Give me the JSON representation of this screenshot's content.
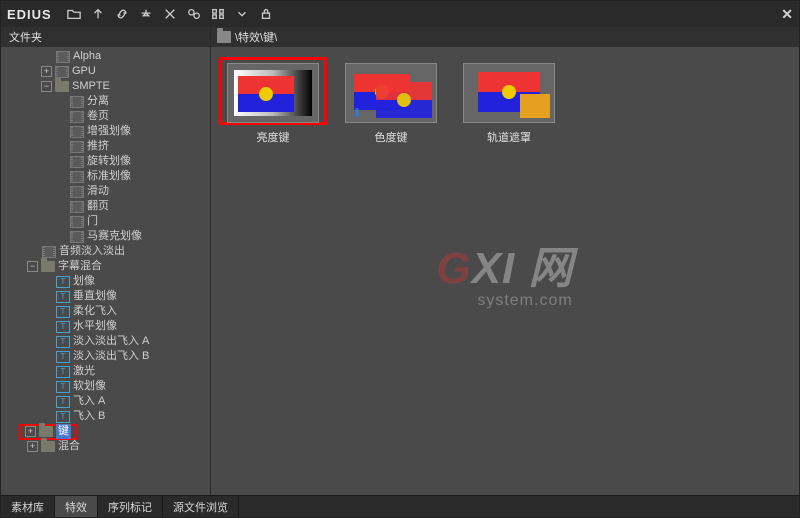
{
  "app": {
    "brand": "EDIUS"
  },
  "sidebar": {
    "title": "文件夹"
  },
  "breadcrumb": "\\特效\\键\\",
  "tree": {
    "alpha": "Alpha",
    "gpu": "GPU",
    "smpte": "SMPTE",
    "smpte_children": [
      "分离",
      "卷页",
      "增强划像",
      "推挤",
      "旋转划像",
      "标准划像",
      "滑动",
      "翻页",
      "门",
      "马赛克划像"
    ],
    "audio_fade": "音频淡入淡出",
    "subtitle_mix": "字幕混合",
    "subtitle_children": [
      "划像",
      "垂直划像",
      "柔化飞入",
      "水平划像",
      "淡入淡出飞入 A",
      "淡入淡出飞入 B",
      "激光",
      "软划像",
      "飞入 A",
      "飞入 B"
    ],
    "key": "键",
    "blend": "混合"
  },
  "thumbs": [
    {
      "label": "亮度键"
    },
    {
      "label": "色度键"
    },
    {
      "label": "轨道遮罩"
    }
  ],
  "watermark": {
    "line1a": "G",
    "line1b": "XI",
    "line1c": "网",
    "line2": "system.com"
  },
  "tabs": [
    "素材库",
    "特效",
    "序列标记",
    "源文件浏览"
  ]
}
